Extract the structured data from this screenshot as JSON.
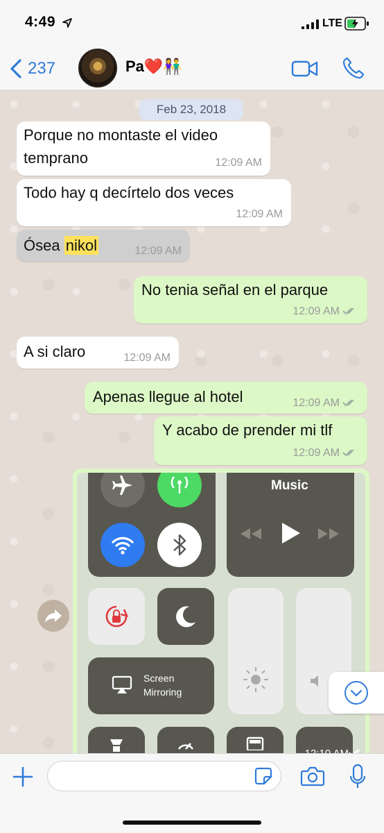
{
  "status_bar": {
    "time": "4:49",
    "network": "LTE",
    "icons": [
      "location-arrow-icon",
      "signal-icon",
      "battery-charging-icon"
    ]
  },
  "header": {
    "back_count": "237",
    "contact_name": "Pa❤️👫",
    "icons": [
      "chevron-left-icon",
      "video-call-icon",
      "phone-call-icon"
    ]
  },
  "chat": {
    "date_chip": "Feb 23, 2018",
    "messages": [
      {
        "direction": "in",
        "text_line1": "Porque no montaste el video",
        "text_line2": "temprano",
        "time": "12:09 AM"
      },
      {
        "direction": "in",
        "text": "Todo hay q decírtelo dos veces",
        "time": "12:09 AM"
      },
      {
        "direction": "in",
        "text_prefix": "Ósea",
        "text_highlight": "nikol",
        "time": "12:09 AM",
        "selected": true
      },
      {
        "direction": "out",
        "text": "No tenia señal en el parque",
        "time": "12:09 AM",
        "status": "read"
      },
      {
        "direction": "in",
        "text": "A si claro",
        "time": "12:09 AM"
      },
      {
        "direction": "out",
        "text": "Apenas llegue al hotel",
        "time": "12:09 AM",
        "status": "read"
      },
      {
        "direction": "out",
        "text": "Y acabo de prender mi tlf",
        "time": "12:09 AM",
        "status": "read"
      }
    ],
    "image_message": {
      "direction": "out",
      "time": "12:10 AM",
      "status": "read",
      "content": {
        "music_label": "Music",
        "screen_mirroring_line1": "Screen",
        "screen_mirroring_line2": "Mirroring",
        "icons": [
          "airplane-icon",
          "cellular-data-icon",
          "wifi-icon",
          "bluetooth-icon",
          "rewind-icon",
          "play-icon",
          "fast-forward-icon",
          "rotation-lock-icon",
          "moon-icon",
          "brightness-icon",
          "volume-icon",
          "airplay-icon",
          "flashlight-icon",
          "timer-icon",
          "calculator-icon"
        ]
      }
    },
    "forward_icon": "forward-icon",
    "scroll_icon": "chevron-down-circle-icon"
  },
  "composer": {
    "value": "",
    "placeholder": "",
    "icons": [
      "plus-icon",
      "sticker-icon",
      "camera-icon",
      "microphone-icon"
    ]
  },
  "colors": {
    "accent": "#2f7bd8",
    "incoming_bubble": "#ffffff",
    "outgoing_bubble": "#dcf8c6",
    "chat_background": "#e5ddd5",
    "highlight": "#ffe25b"
  }
}
